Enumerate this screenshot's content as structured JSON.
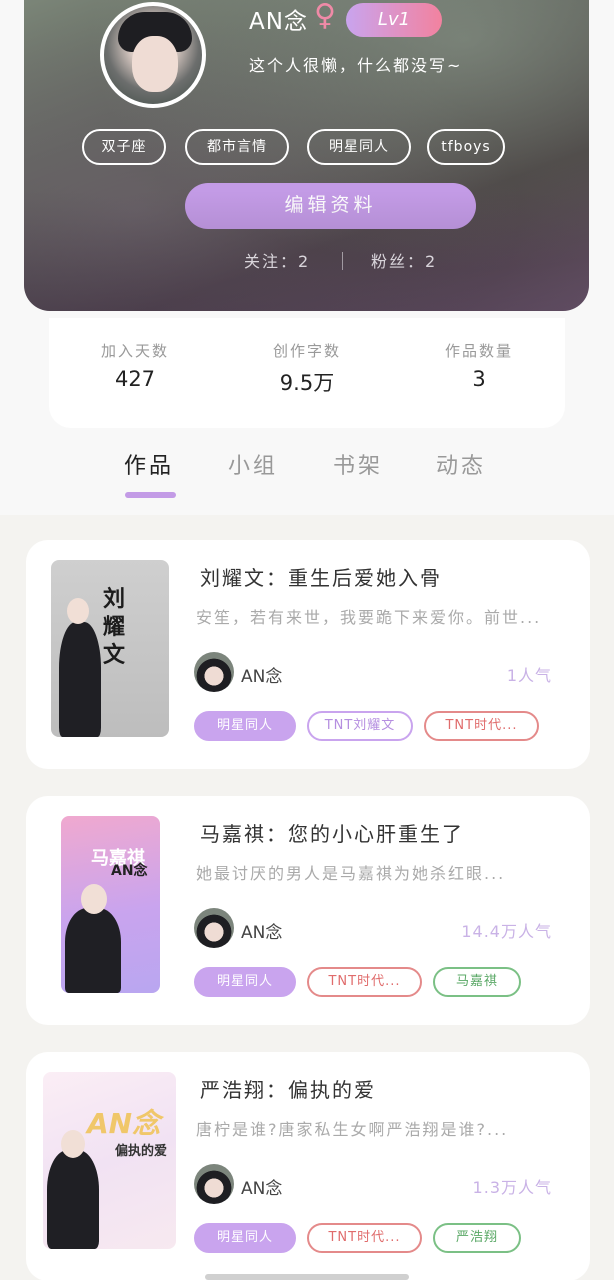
{
  "profile": {
    "username": "AN念",
    "gender_symbol": "♀",
    "level": "Lv1",
    "bio": "这个人很懒，什么都没写~",
    "tags": [
      "双子座",
      "都市言情",
      "明星同人",
      "tfboys"
    ],
    "edit_label": "编辑资料",
    "following_label": "关注：2",
    "fans_label": "粉丝：2"
  },
  "stats": [
    {
      "label": "加入天数",
      "value": "427"
    },
    {
      "label": "创作字数",
      "value": "9.5万"
    },
    {
      "label": "作品数量",
      "value": "3"
    }
  ],
  "tabs": [
    "作品",
    "小组",
    "书架",
    "动态"
  ],
  "active_tab": "作品",
  "works": [
    {
      "title": "刘耀文：重生后爱她入骨",
      "desc": "安笙，若有来世，我要跪下来爱你。前世...",
      "author": "AN念",
      "popularity": "1人气",
      "cover_text": "刘耀文",
      "chips": [
        "明星同人",
        "TNT刘耀文",
        "TNT时代..."
      ]
    },
    {
      "title": "马嘉祺：您的小心肝重生了",
      "desc": "她最讨厌的男人是马嘉祺为她杀红眼...",
      "author": "AN念",
      "popularity": "14.4万人气",
      "cover_text": "马嘉祺",
      "cover_text_2": "AN念",
      "chips": [
        "明星同人",
        "TNT时代...",
        "马嘉祺"
      ]
    },
    {
      "title": "严浩翔：偏执的爱",
      "desc": "唐柠是谁?唐家私生女啊严浩翔是谁?...",
      "author": "AN念",
      "popularity": "1.3万人气",
      "cover_text": "AN念",
      "cover_text_2": "偏执的爱",
      "chips": [
        "明星同人",
        "TNT时代...",
        "严浩翔"
      ]
    }
  ],
  "colors": {
    "accent_purple": "#c39be6",
    "chip_red": "#e06c6c",
    "chip_green": "#5aa866"
  }
}
